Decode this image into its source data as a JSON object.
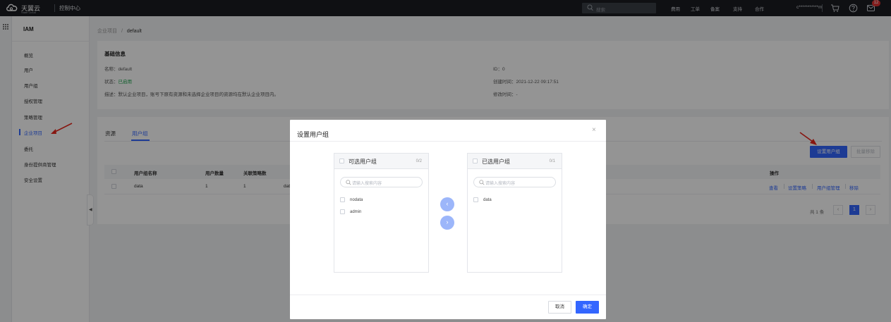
{
  "topbar": {
    "brand": "天翼云",
    "brand_sub": "State Cloud",
    "console": "控制中心",
    "search_placeholder": "搜索",
    "links": [
      "费用",
      "工单",
      "备案",
      "支持",
      "合作"
    ],
    "account": "c***********m",
    "notification_count": "12"
  },
  "sidebar": {
    "title": "IAM",
    "items": [
      "概览",
      "用户",
      "用户组",
      "授权管理",
      "策略管理",
      "企业项目",
      "委托",
      "身份提供商管理",
      "安全设置"
    ],
    "active_index": 5
  },
  "breadcrumb": {
    "parent": "企业项目",
    "separator": "/",
    "current": "default"
  },
  "basic_info": {
    "title": "基础信息",
    "name": "名称：default",
    "status_label": "状态：",
    "status_value": "已启用",
    "description": "描述：默认企业项目，账号下原有资源和未选择企业项目的资源均在默认企业项目内。",
    "id": "ID：0",
    "created": "创建时间：2021-12-22 09:17:51",
    "modified": "修改时间：-"
  },
  "tabs": [
    "资源",
    "用户组"
  ],
  "actions": {
    "set_group": "设置用户组",
    "batch_remove": "批量移除"
  },
  "table": {
    "headers": [
      "用户组名称",
      "用户数量",
      "关联策略数",
      "操作"
    ],
    "rows": [
      {
        "name": "data",
        "users": "1",
        "policies": "1",
        "extra": "dat"
      }
    ],
    "row_actions": [
      "查看",
      "设置策略",
      "用户组管理",
      "移除"
    ]
  },
  "pagination": {
    "total": "共 1 条",
    "prev": "‹",
    "page": "1",
    "next": "›"
  },
  "modal": {
    "title": "设置用户组",
    "close": "×",
    "left_panel": {
      "title": "可选用户组",
      "count": "0/2",
      "search_placeholder": "请输入搜索内容",
      "items": [
        "nodata",
        "admin"
      ]
    },
    "right_panel": {
      "title": "已选用户组",
      "count": "0/1",
      "search_placeholder": "请输入搜索内容",
      "items": [
        "data"
      ]
    },
    "move_left": "‹",
    "move_right": "›",
    "cancel": "取消",
    "confirm": "确定"
  }
}
